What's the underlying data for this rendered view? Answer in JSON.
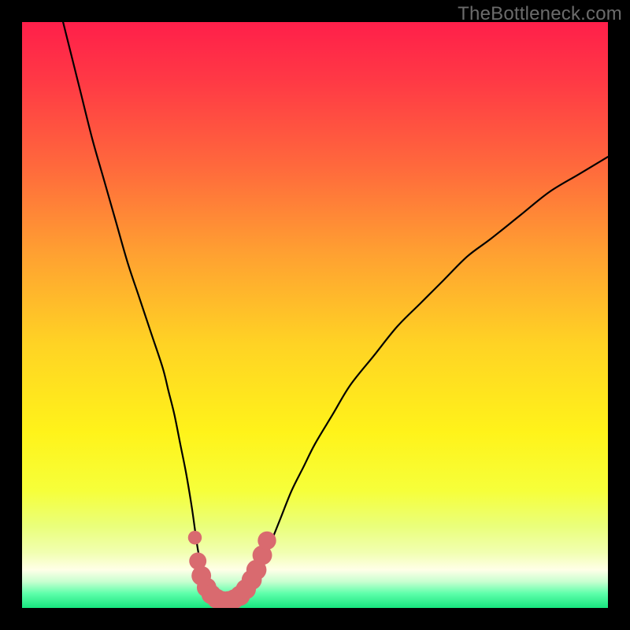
{
  "watermark": "TheBottleneck.com",
  "colors": {
    "frame": "#000000",
    "curve": "#000000",
    "markers": "#d96a6f",
    "gradient_stops": [
      {
        "offset": 0.0,
        "color": "#ff1f4a"
      },
      {
        "offset": 0.1,
        "color": "#ff3945"
      },
      {
        "offset": 0.25,
        "color": "#ff6a3c"
      },
      {
        "offset": 0.4,
        "color": "#ffa231"
      },
      {
        "offset": 0.55,
        "color": "#ffd324"
      },
      {
        "offset": 0.7,
        "color": "#fff31a"
      },
      {
        "offset": 0.8,
        "color": "#f6ff3a"
      },
      {
        "offset": 0.86,
        "color": "#eaff7a"
      },
      {
        "offset": 0.905,
        "color": "#f1ffb0"
      },
      {
        "offset": 0.935,
        "color": "#ffffe8"
      },
      {
        "offset": 0.955,
        "color": "#c8ffd0"
      },
      {
        "offset": 0.975,
        "color": "#5fffab"
      },
      {
        "offset": 1.0,
        "color": "#17e57e"
      }
    ]
  },
  "chart_data": {
    "type": "line",
    "title": "",
    "xlabel": "",
    "ylabel": "",
    "xlim": [
      0,
      100
    ],
    "ylim": [
      0,
      100
    ],
    "grid": false,
    "legend": false,
    "series": [
      {
        "name": "bottleneck-curve",
        "x": [
          7,
          8,
          9,
          10,
          12,
          14,
          16,
          18,
          20,
          22,
          24,
          25,
          26,
          27,
          28,
          29,
          30,
          31,
          32,
          33,
          34,
          35,
          36,
          38,
          40,
          42,
          44,
          46,
          48,
          50,
          53,
          56,
          60,
          64,
          68,
          72,
          76,
          80,
          85,
          90,
          95,
          100
        ],
        "y": [
          100,
          96,
          92,
          88,
          80,
          73,
          66,
          59,
          53,
          47,
          41,
          37,
          33,
          28,
          23,
          17,
          10,
          5,
          2.5,
          1.5,
          1.2,
          1.2,
          1.5,
          2.5,
          5,
          10,
          15,
          20,
          24,
          28,
          33,
          38,
          43,
          48,
          52,
          56,
          60,
          63,
          67,
          71,
          74,
          77
        ]
      }
    ],
    "markers": {
      "name": "emphasis-near-minimum",
      "points": [
        {
          "x": 29.5,
          "y": 12,
          "r": 1.0
        },
        {
          "x": 30.0,
          "y": 8,
          "r": 1.6
        },
        {
          "x": 30.6,
          "y": 5.5,
          "r": 2.0
        },
        {
          "x": 31.5,
          "y": 3.5,
          "r": 2.0
        },
        {
          "x": 32.3,
          "y": 2.3,
          "r": 2.0
        },
        {
          "x": 33.2,
          "y": 1.6,
          "r": 2.0
        },
        {
          "x": 34.2,
          "y": 1.2,
          "r": 2.0
        },
        {
          "x": 35.2,
          "y": 1.2,
          "r": 2.0
        },
        {
          "x": 36.2,
          "y": 1.5,
          "r": 2.0
        },
        {
          "x": 37.2,
          "y": 2.1,
          "r": 2.1
        },
        {
          "x": 38.2,
          "y": 3.2,
          "r": 2.1
        },
        {
          "x": 39.2,
          "y": 4.8,
          "r": 2.1
        },
        {
          "x": 40.0,
          "y": 6.5,
          "r": 2.1
        },
        {
          "x": 41.0,
          "y": 9.0,
          "r": 2.0
        },
        {
          "x": 41.8,
          "y": 11.5,
          "r": 1.8
        }
      ]
    }
  }
}
